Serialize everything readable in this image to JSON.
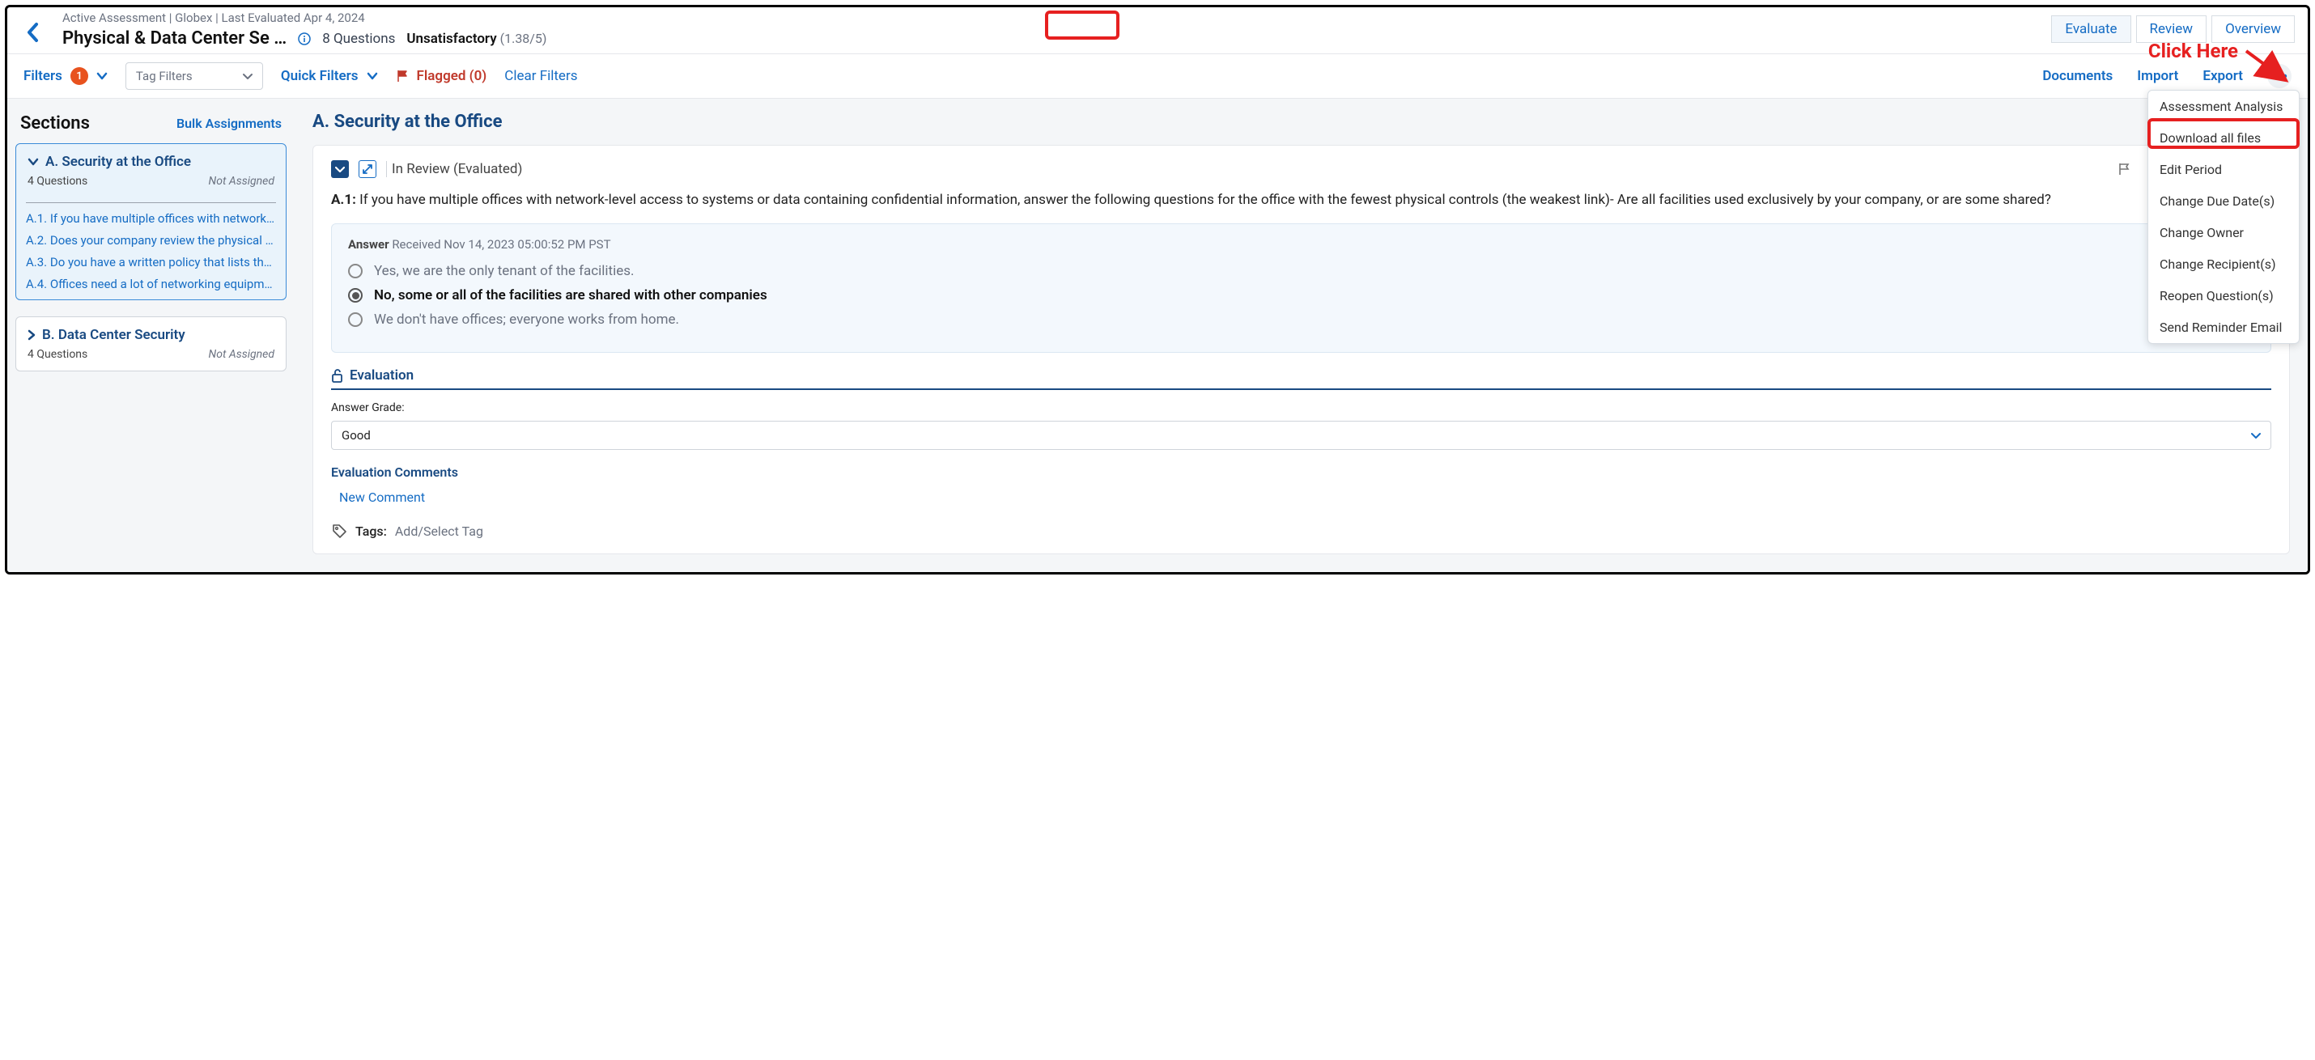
{
  "crumbs": {
    "status": "Active Assessment",
    "vendor": "Globex",
    "last_eval": "Last Evaluated Apr 4, 2024"
  },
  "header": {
    "title": "Physical & Data Center Se …",
    "question_count": "8 Questions",
    "rating_label": "Unsatisfactory",
    "rating_value": "(1.38/5)"
  },
  "tabs": {
    "evaluate": "Evaluate",
    "review": "Review",
    "overview": "Overview"
  },
  "filters": {
    "label": "Filters",
    "count": "1",
    "tag_placeholder": "Tag Filters",
    "quick": "Quick Filters",
    "flagged": "Flagged (0)",
    "clear": "Clear Filters",
    "documents": "Documents",
    "import": "Import",
    "export": "Export"
  },
  "sections": {
    "heading": "Sections",
    "bulk": "Bulk Assignments",
    "a": {
      "title": "A. Security at the Office",
      "qcount": "4 Questions",
      "assigned": "Not Assigned",
      "questions": [
        "A.1. If you have multiple offices with network-le…",
        "A.2. Does your company review the physical an…",
        "A.3. Do you have a written policy that lists the p…",
        "A.4. Offices need a lot of networking equipment…"
      ]
    },
    "b": {
      "title": "B. Data Center Security",
      "qcount": "4 Questions",
      "assigned": "Not Assigned"
    }
  },
  "content": {
    "heading": "A. Security at the Office",
    "status": "In Review (Evaluated)",
    "q_id": "A.1:",
    "q_text": "If you have multiple offices with network-level access to systems or data containing confidential information, answer the following questions for the office with the fewest physical controls (the weakest link)- Are all facilities used exclusively by your company, or are some shared?",
    "answer_label": "Answer",
    "received": "Received Nov 14, 2023 05:00:52 PM PST",
    "options": [
      "Yes, we are the only tenant of the facilities.",
      "No, some or all of the facilities are shared with other companies",
      "We don't have offices; everyone works from home."
    ],
    "selected_index": 1,
    "evaluation_label": "Evaluation",
    "grade_label": "Answer Grade:",
    "grade_value": "Good",
    "eval_comments_label": "Evaluation Comments",
    "new_comment": "New Comment",
    "tags_label": "Tags:",
    "tags_placeholder": "Add/Select Tag"
  },
  "menu": {
    "items": [
      "Assessment Analysis",
      "Download all files",
      "Edit Period",
      "Change Due Date(s)",
      "Change Owner",
      "Change Recipient(s)",
      "Reopen Question(s)",
      "Send Reminder Email"
    ],
    "highlight_index": 1
  },
  "annotation": {
    "click_here": "Click Here"
  }
}
